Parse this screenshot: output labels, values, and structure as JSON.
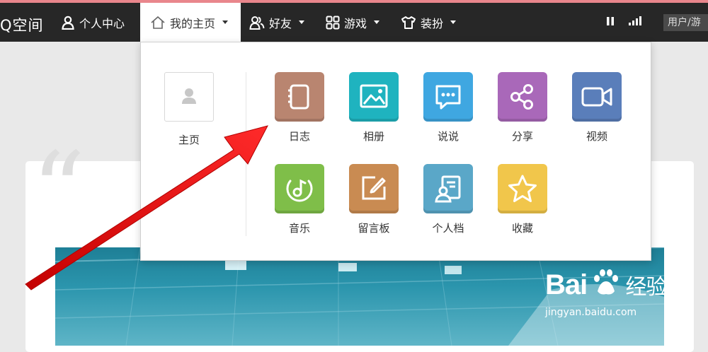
{
  "nav": {
    "brand": "Q空间",
    "items": [
      {
        "label": "个人中心"
      },
      {
        "label": "我的主页"
      },
      {
        "label": "好友"
      },
      {
        "label": "游戏"
      },
      {
        "label": "装扮"
      }
    ],
    "user_box": "用户/游"
  },
  "menu": {
    "home_label": "主页",
    "apps": [
      {
        "label": "日志",
        "color": "#b98570",
        "icon": "notebook-icon"
      },
      {
        "label": "相册",
        "color": "#1fb3bf",
        "icon": "image-icon"
      },
      {
        "label": "说说",
        "color": "#3fa7e1",
        "icon": "chat-bubble-icon"
      },
      {
        "label": "分享",
        "color": "#a968b9",
        "icon": "share-icon"
      },
      {
        "label": "视频",
        "color": "#5a7eba",
        "icon": "video-camera-icon"
      },
      {
        "label": "音乐",
        "color": "#7fbe49",
        "icon": "music-note-icon"
      },
      {
        "label": "留言板",
        "color": "#c98b52",
        "icon": "edit-square-icon"
      },
      {
        "label": "个人档",
        "color": "#5aa7c8",
        "icon": "profile-card-icon"
      },
      {
        "label": "收藏",
        "color": "#f1c64b",
        "icon": "star-icon"
      }
    ]
  },
  "watermark": {
    "brand": "Bai",
    "brand_suffix": "经验",
    "url": "jingyan.baidu.com"
  }
}
